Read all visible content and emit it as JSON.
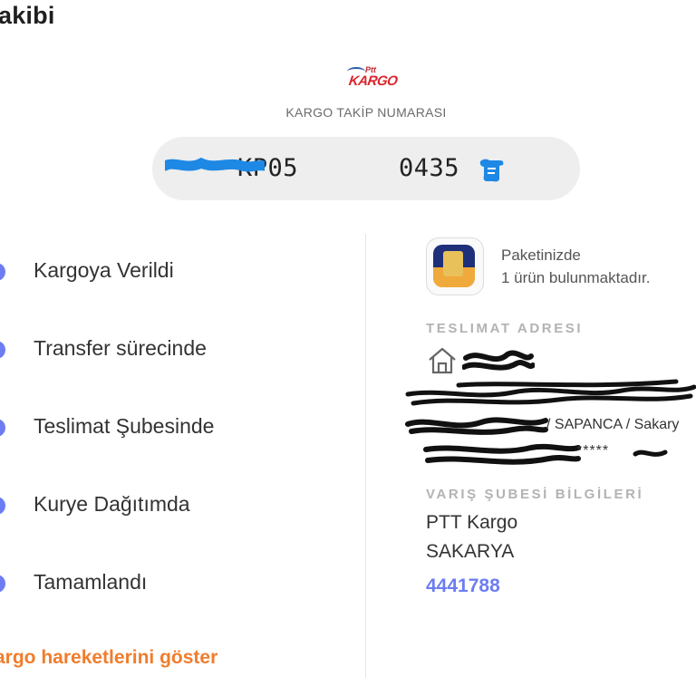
{
  "header": {
    "title": "akibi"
  },
  "brand": {
    "logo_small": "Ptt",
    "logo_main": "KARGO"
  },
  "tracking": {
    "label": "KARGO TAKİP NUMARASI",
    "number_prefix": "KP05",
    "number_suffix": "0435",
    "copy_icon": "copy-icon"
  },
  "steps": [
    {
      "label": "Kargoya Verildi"
    },
    {
      "label": "Transfer sürecinde"
    },
    {
      "label": "Teslimat Şubesinde"
    },
    {
      "label": "Kurye Dağıtımda"
    },
    {
      "label": "Tamamlandı"
    }
  ],
  "show_moves": "argo hareketlerini göster",
  "package": {
    "line1": "Paketinizde",
    "line2": "1 ürün bulunmaktadır."
  },
  "delivery": {
    "heading": "TESLIMAT ADRESI",
    "address_visible": "/ SAPANCA / Sakary",
    "address_masked": "*****"
  },
  "branch": {
    "heading": "VARIŞ ŞUBESİ BİLGİLERİ",
    "name": "PTT Kargo",
    "city": "SAKARYA",
    "phone": "4441788"
  },
  "colors": {
    "accent": "#6c7df2",
    "link": "#f07d2d",
    "copy": "#1e88e5"
  }
}
